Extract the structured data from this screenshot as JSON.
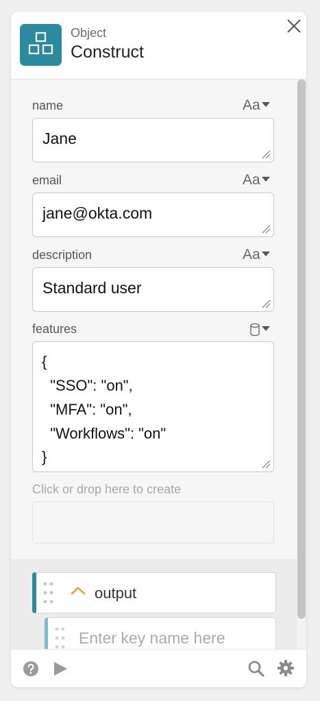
{
  "card": {
    "type_label": "Object",
    "title": "Construct",
    "icons": {
      "logo": "object-construct-icon",
      "close": "close-icon"
    }
  },
  "fields": [
    {
      "label": "name",
      "type_select": "Aa",
      "value": "Jane"
    },
    {
      "label": "email",
      "type_select": "Aa",
      "value": "jane@okta.com"
    },
    {
      "label": "description",
      "type_select": "Aa",
      "value": "Standard user"
    }
  ],
  "features": {
    "label": "features",
    "type_icon": "database-icon",
    "lines": [
      "{",
      "  \"SSO\": \"on\",",
      "  \"MFA\": \"on\",",
      "  \"Workflows\": \"on\"",
      "}"
    ]
  },
  "create_hint": "Click or drop here to create",
  "output": {
    "label": "output",
    "key_placeholder": "Enter key name here"
  },
  "footer": {
    "icons": [
      "help-icon",
      "play-icon",
      "search-icon",
      "gear-icon"
    ]
  },
  "colors": {
    "accent": "#2a8a9e",
    "chevron": "#f0a030"
  }
}
